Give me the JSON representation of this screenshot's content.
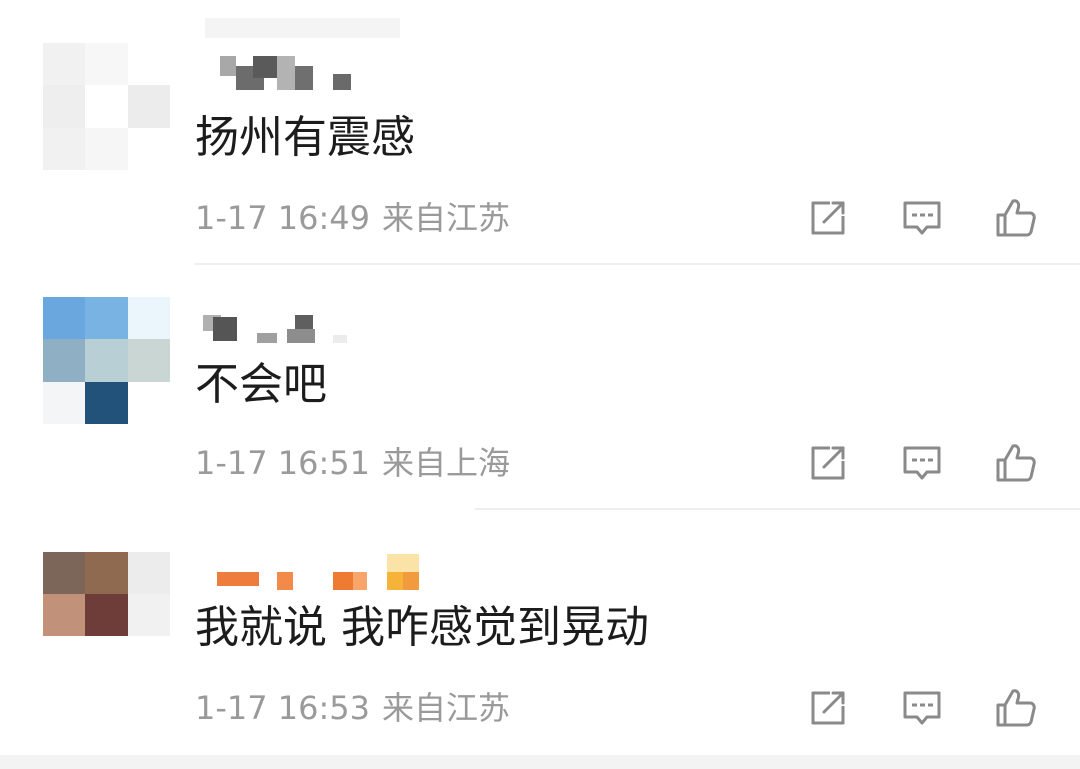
{
  "comments": [
    {
      "text": "扬州有震感",
      "time": "1-17 16:49",
      "source": "来自江苏",
      "avatar_colors": [
        "#f1f1f1",
        "#f7f7f7",
        "#ffffff",
        "#eeeeee",
        "#ffffff",
        "#ececec",
        "#f1f1f1",
        "#f6f6f6",
        "#ffffff"
      ]
    },
    {
      "text": "不会吧",
      "time": "1-17 16:51",
      "source": "来自上海",
      "avatar_colors": [
        "#6aa7df",
        "#78b3e4",
        "#eaf6fb",
        "#8eafc4",
        "#b8cfd6",
        "#c9d6d3",
        "#f4f5f6",
        "#22527a",
        "#ffffff"
      ]
    },
    {
      "text": "我就说 我咋感觉到晃动",
      "time": "1-17 16:53",
      "source": "来自江苏",
      "avatar_colors": [
        "#7b6659",
        "#8f6a50",
        "#ececec",
        "#c2917a",
        "#6e3d3a",
        "#f1f1f1",
        "#ffffff",
        "#ffffff",
        "#ffffff"
      ]
    }
  ],
  "icons": {
    "share": "share-icon",
    "reply": "comment-icon",
    "like": "thumbs-up-icon"
  },
  "colors": {
    "text": "#1c1c1c",
    "meta": "#9a9a9a",
    "icon": "#8a8a8a",
    "divider": "#eeeeee"
  }
}
